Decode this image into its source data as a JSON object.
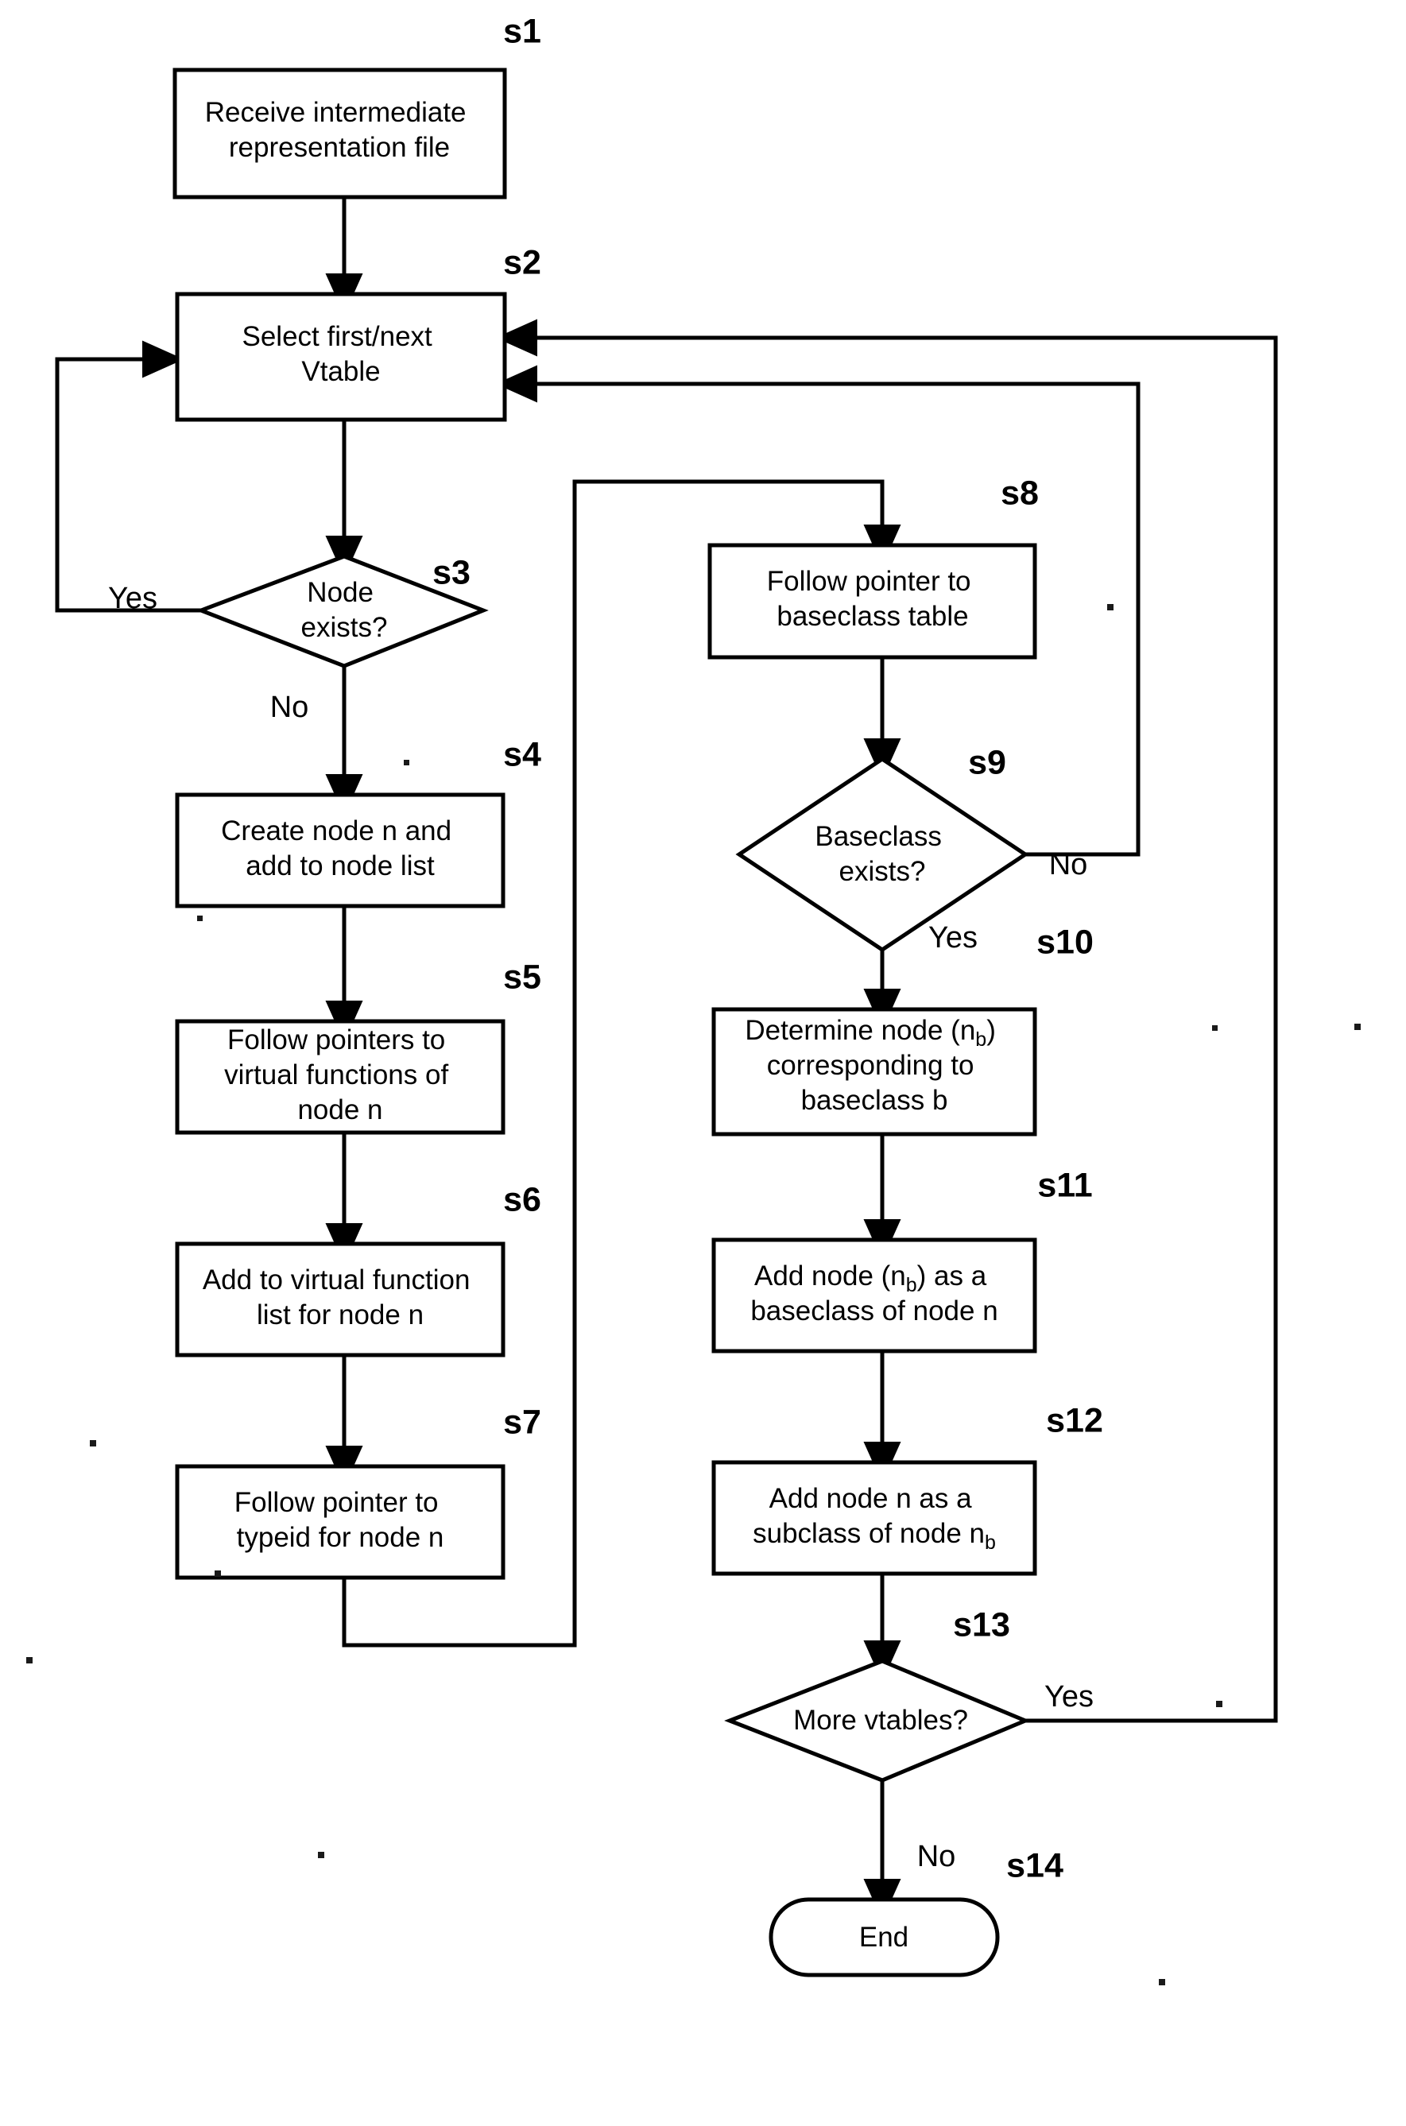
{
  "diagram": {
    "title": "Vtable to class-hierarchy node construction flowchart",
    "type": "flowchart",
    "orientation": "top-to-bottom, two columns",
    "ink_color": "#000000",
    "background_color": "#ffffff"
  },
  "nodes": [
    {
      "id": "s1",
      "step_label": "s1",
      "shape": "rectangle",
      "lines": [
        "Receive intermediate",
        "representation file"
      ]
    },
    {
      "id": "s2",
      "step_label": "s2",
      "shape": "rectangle",
      "lines": [
        "Select first/next",
        "Vtable"
      ]
    },
    {
      "id": "s3",
      "step_label": "s3",
      "shape": "diamond",
      "lines": [
        "Node",
        "exists?"
      ]
    },
    {
      "id": "s4",
      "step_label": "s4",
      "shape": "rectangle",
      "lines": [
        "Create node n and",
        "add to node list"
      ]
    },
    {
      "id": "s5",
      "step_label": "s5",
      "shape": "rectangle",
      "lines": [
        "Follow pointers to",
        "virtual functions of",
        "node n"
      ]
    },
    {
      "id": "s6",
      "step_label": "s6",
      "shape": "rectangle",
      "lines": [
        "Add to virtual function",
        "list for node n"
      ]
    },
    {
      "id": "s7",
      "step_label": "s7",
      "shape": "rectangle",
      "lines": [
        "Follow pointer to",
        "typeid for node n"
      ]
    },
    {
      "id": "s8",
      "step_label": "s8",
      "shape": "rectangle",
      "lines": [
        "Follow pointer to",
        "baseclass table"
      ]
    },
    {
      "id": "s9",
      "step_label": "s9",
      "shape": "diamond",
      "lines": [
        "Baseclass",
        "exists?"
      ]
    },
    {
      "id": "s10",
      "step_label": "s10",
      "shape": "rectangle",
      "lines": [
        "Determine node (n|b|)",
        "corresponding to",
        "baseclass b"
      ]
    },
    {
      "id": "s11",
      "step_label": "s11",
      "shape": "rectangle",
      "lines": [
        "Add node (n|b|) as a",
        "baseclass of node n"
      ]
    },
    {
      "id": "s12",
      "step_label": "s12",
      "shape": "rectangle",
      "lines": [
        "Add node n as a",
        "subclass of node n|b|"
      ]
    },
    {
      "id": "s13",
      "step_label": "s13",
      "shape": "diamond",
      "lines": [
        "More vtables?"
      ]
    },
    {
      "id": "s14",
      "step_label": "s14",
      "shape": "terminator",
      "lines": [
        "End"
      ]
    }
  ],
  "edge_labels": {
    "s3_yes": "Yes",
    "s3_no": "No",
    "s9_no": "No",
    "s9_yes": "Yes",
    "s13_yes": "Yes",
    "s13_no": "No"
  },
  "edges": [
    {
      "from": "s1",
      "to": "s2",
      "label": ""
    },
    {
      "from": "s2",
      "to": "s3",
      "label": ""
    },
    {
      "from": "s3",
      "to": "s2",
      "label": "Yes",
      "route": "left loop back up"
    },
    {
      "from": "s3",
      "to": "s4",
      "label": "No"
    },
    {
      "from": "s4",
      "to": "s5",
      "label": ""
    },
    {
      "from": "s5",
      "to": "s6",
      "label": ""
    },
    {
      "from": "s6",
      "to": "s7",
      "label": ""
    },
    {
      "from": "s7",
      "to": "s8",
      "label": "",
      "route": "down, left, up, right into s8"
    },
    {
      "from": "s8",
      "to": "s9",
      "label": ""
    },
    {
      "from": "s9",
      "to": "s2",
      "label": "No",
      "route": "right then up to s2"
    },
    {
      "from": "s9",
      "to": "s10",
      "label": "Yes"
    },
    {
      "from": "s10",
      "to": "s11",
      "label": ""
    },
    {
      "from": "s11",
      "to": "s12",
      "label": ""
    },
    {
      "from": "s12",
      "to": "s13",
      "label": ""
    },
    {
      "from": "s13",
      "to": "s2",
      "label": "Yes",
      "route": "far right then up to s2"
    },
    {
      "from": "s13",
      "to": "s14",
      "label": "No"
    }
  ]
}
